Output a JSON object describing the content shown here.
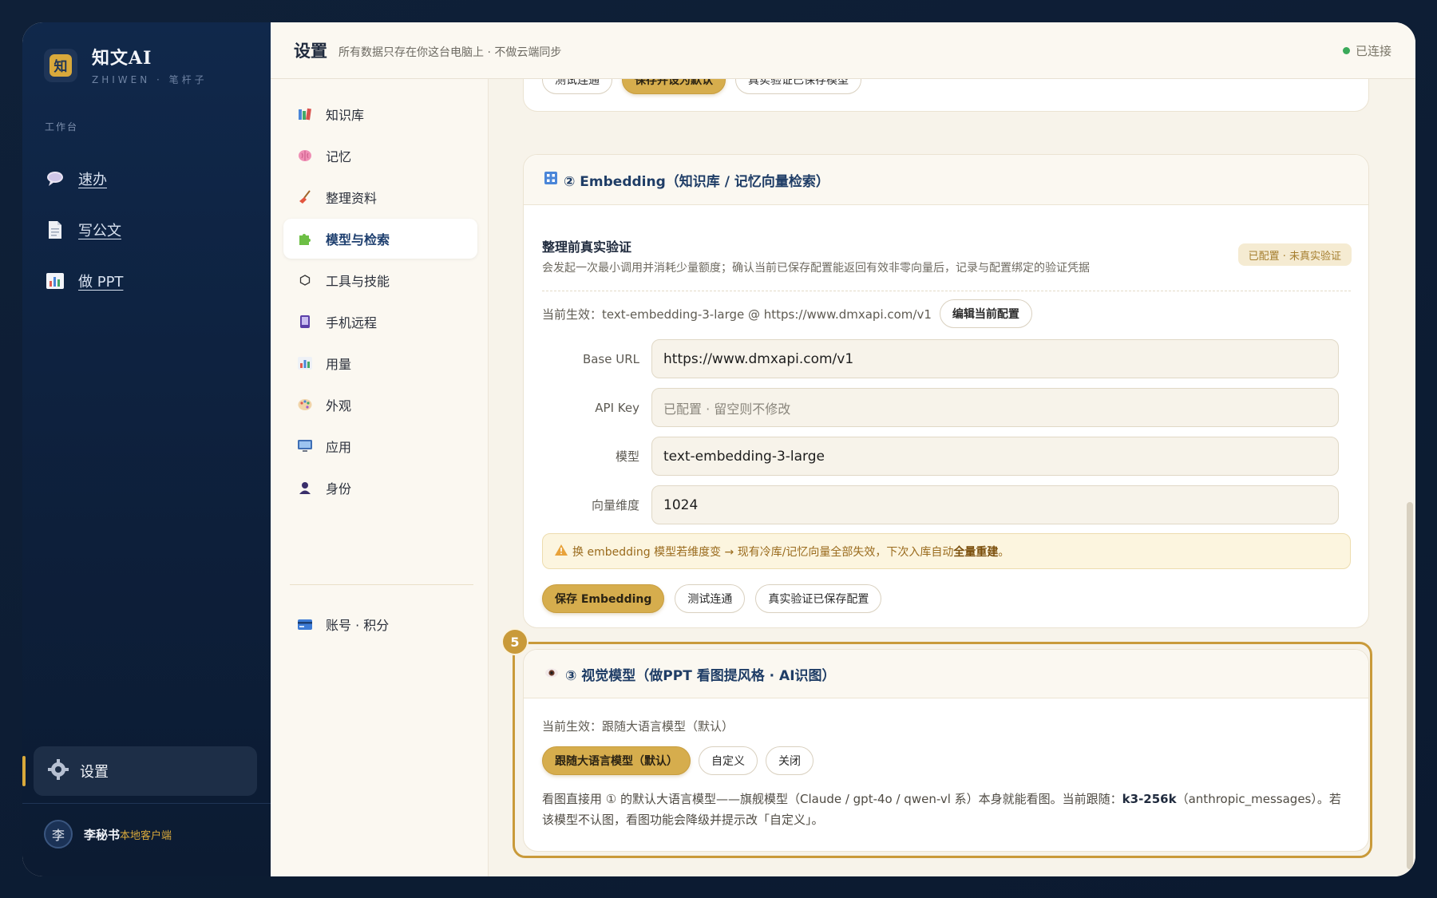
{
  "app": {
    "name": "知文AI",
    "subtitle": "ZHIWEN · 笔杆子",
    "logo_char": "知"
  },
  "sidebar": {
    "section_label": "工作台",
    "items": [
      {
        "label": "速办",
        "icon": "speech-bubble-icon"
      },
      {
        "label": "写公文",
        "icon": "document-icon"
      },
      {
        "label": "做 PPT",
        "icon": "bar-chart-icon"
      }
    ],
    "settings_label": "设置",
    "user": {
      "avatar_char": "李",
      "name": "李秘书",
      "tag": "本地客户端"
    }
  },
  "header": {
    "title": "设置",
    "subtitle": "所有数据只存在你这台电脑上 · 不做云端同步",
    "status": "已连接",
    "status_color": "#3aaa5a"
  },
  "subnav": {
    "items": [
      {
        "label": "知识库",
        "icon": "books-icon"
      },
      {
        "label": "记忆",
        "icon": "brain-icon"
      },
      {
        "label": "整理资料",
        "icon": "broom-icon"
      },
      {
        "label": "模型与检索",
        "icon": "puzzle-icon",
        "active": true
      },
      {
        "label": "工具与技能",
        "icon": "hexagon-icon"
      },
      {
        "label": "手机远程",
        "icon": "phone-icon"
      },
      {
        "label": "用量",
        "icon": "chart-icon"
      },
      {
        "label": "外观",
        "icon": "palette-icon"
      },
      {
        "label": "应用",
        "icon": "monitor-icon"
      },
      {
        "label": "身份",
        "icon": "person-icon"
      }
    ],
    "account_label": "账号 · 积分"
  },
  "top_card": {
    "buttons": [
      "测试连通",
      "保存并设为默认",
      "真实验证已保存模型"
    ]
  },
  "embedding": {
    "heading": "② Embedding（知识库 / 记忆向量检索）",
    "verify_title": "整理前真实验证",
    "verify_desc": "会发起一次最小调用并消耗少量额度；确认当前已保存配置能返回有效非零向量后，记录与配置绑定的验证凭据",
    "badge": "已配置 · 未真实验证",
    "current_label": "当前生效：text-embedding-3-large @ https://www.dmxapi.com/v1",
    "edit_button": "编辑当前配置",
    "fields": {
      "base_url_label": "Base URL",
      "base_url_value": "https://www.dmxapi.com/v1",
      "api_key_label": "API Key",
      "api_key_placeholder": "已配置 · 留空则不修改",
      "model_label": "模型",
      "model_value": "text-embedding-3-large",
      "dim_label": "向量维度",
      "dim_value": "1024"
    },
    "warning_prefix": "换 embedding 模型若维度变 → 现有冷库/记忆向量全部失效，下次入库自动",
    "warning_bold": "全量重建",
    "warning_suffix": "。",
    "buttons": [
      "保存 Embedding",
      "测试连通",
      "真实验证已保存配置"
    ]
  },
  "vision": {
    "step": "5",
    "heading": "③ 视觉模型（做PPT 看图提风格 · AI识图）",
    "current_label": "当前生效：跟随大语言模型（默认）",
    "options": [
      "跟随大语言模型（默认）",
      "自定义",
      "关闭"
    ],
    "desc_prefix": "看图直接用 ① 的默认大语言模型——旗舰模型（Claude / gpt-4o / qwen-vl 系）本身就能看图。当前跟随：",
    "desc_model": "k3-256k",
    "desc_suffix": "（anthropic_messages）。若该模型不认图，看图功能会降级并提示改「自定义」。"
  },
  "colors": {
    "accent": "#d6ad4d",
    "sidebar_bg": "#10284b",
    "page_bg": "#f7f3ea"
  }
}
